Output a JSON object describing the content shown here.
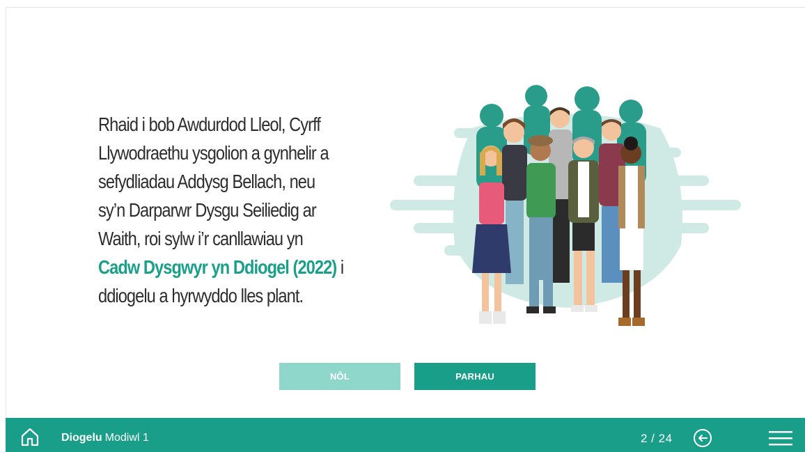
{
  "content": {
    "lines": [
      "Rhaid i bob Awdurdod Lleol, Cyrff",
      "Llywodraethu ysgolion a gynhelir a",
      "sefydliadau Addysg Bellach, neu",
      "sy’n Darparwr Dysgu Seiliedig ar",
      "Waith, roi sylw i’r canllawiau yn"
    ],
    "link_text": "Cadw Dysgwyr yn Ddiogel (2022)",
    "after_link": " i",
    "last_line": "ddiogelu a hyrwyddo lles plant."
  },
  "buttons": {
    "back_label": "NÔL",
    "next_label": "PARHAU"
  },
  "footer": {
    "course_bold": "Diogelu",
    "course_module": "Modiwl 1",
    "page_indicator": "2 / 24",
    "icons": [
      "home-icon",
      "back-arrow-icon",
      "hamburger-menu-icon"
    ]
  },
  "colors": {
    "accent": "#189e89",
    "accent_light": "#8fd7cb",
    "link": "#1a9f8a",
    "text": "#2d2d2d"
  }
}
